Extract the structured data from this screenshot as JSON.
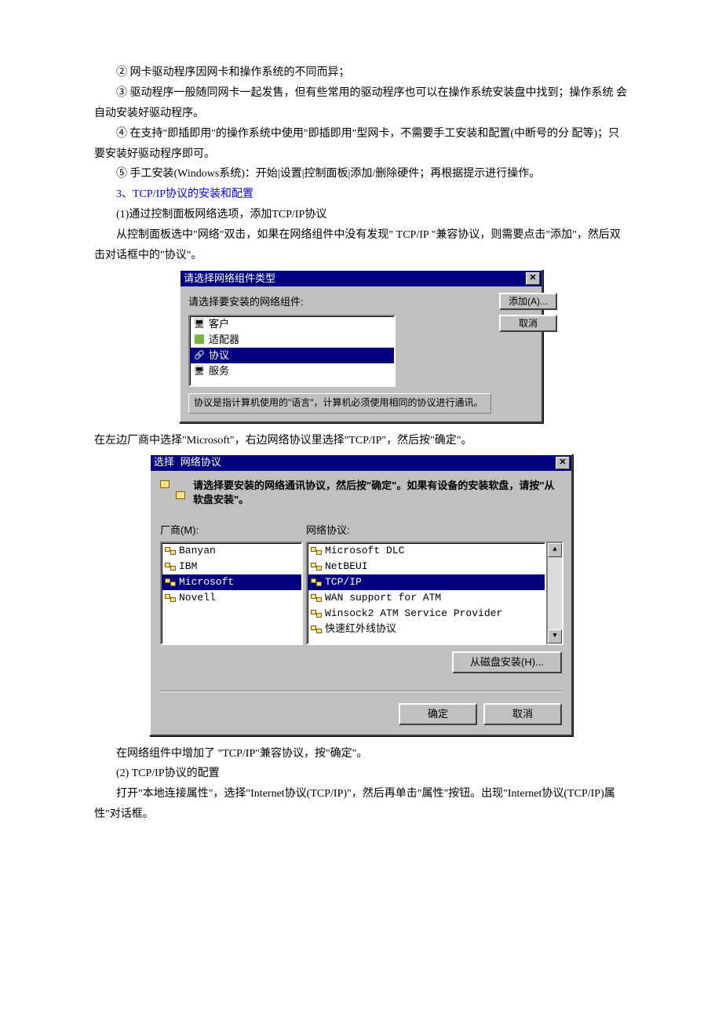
{
  "para1": "② 网卡驱动程序因网卡和操作系统的不同而异；",
  "para2": "③ 驱动程序一般随同网卡一起发售，但有些常用的驱动程序也可以在操作系统安装盘中找到；操作系统 会自动安装好驱动程序。",
  "para3": "④ 在支持\"即插即用\"的操作系统中使用\"即插即用\"型网卡，不需要手工安装和配置(中断号的分 配等)；只要安装好驱动程序即可。",
  "para4": "⑤ 手工安装(Windows系统)：开始|设置|控制面板|添加/删除硬件；再根据提示进行操作。",
  "para5": "3、TCP/IP协议的安装和配置",
  "para6": "(1)通过控制面板网络选项，添加TCP/IP协议",
  "para7": "从控制面板选中\"网络\"双击，如果在网络组件中没有发现\" TCP/IP \"兼容协议，则需要点击\"添加\"，然后双击对话框中的\"协议\"。",
  "dlg1": {
    "title": "请选择网络组件类型",
    "prompt": "请选择要安装的网络组件:",
    "items": [
      "客户",
      "适配器",
      "协议",
      "服务"
    ],
    "selected": 2,
    "actions": {
      "add": "添加(A)...",
      "cancel": "取消"
    },
    "hint": "协议是指计算机使用的\"语言\"，计算机必须使用相同的协议进行通讯。"
  },
  "para_mid": "在左边厂商中选择\"Microsoft\"，右边网络协议里选择\"TCP/IP\"，然后按\"确定\"。",
  "dlg2": {
    "title": "选择 网络协议",
    "instr": "请选择要安装的网络通讯协议，然后按\"确定\"。如果有设备的安装软盘，请按\"从软盘安装\"。",
    "vendor_label": "厂商(M):",
    "proto_label": "网络协议:",
    "vendors": [
      "Banyan",
      "IBM",
      "Microsoft",
      "Novell"
    ],
    "vendor_selected": 2,
    "protocols": [
      "Microsoft DLC",
      "NetBEUI",
      "TCP/IP",
      "WAN support for ATM",
      "Winsock2 ATM Service Provider",
      "快速红外线协议"
    ],
    "proto_selected": 2,
    "disk_btn": "从磁盘安装(H)...",
    "ok": "确定",
    "cancel": "取消"
  },
  "para8": "在网络组件中增加了 \"TCP/IP\"兼容协议，按\"确定\"。",
  "para9": "(2) TCP/IP协议的配置",
  "para10": "打开\"本地连接属性\"，选择\"Internet协议(TCP/IP)\"，然后再单击\"属性\"按钮。出现\"Internet协议(TCP/IP)属性\"对话框。"
}
